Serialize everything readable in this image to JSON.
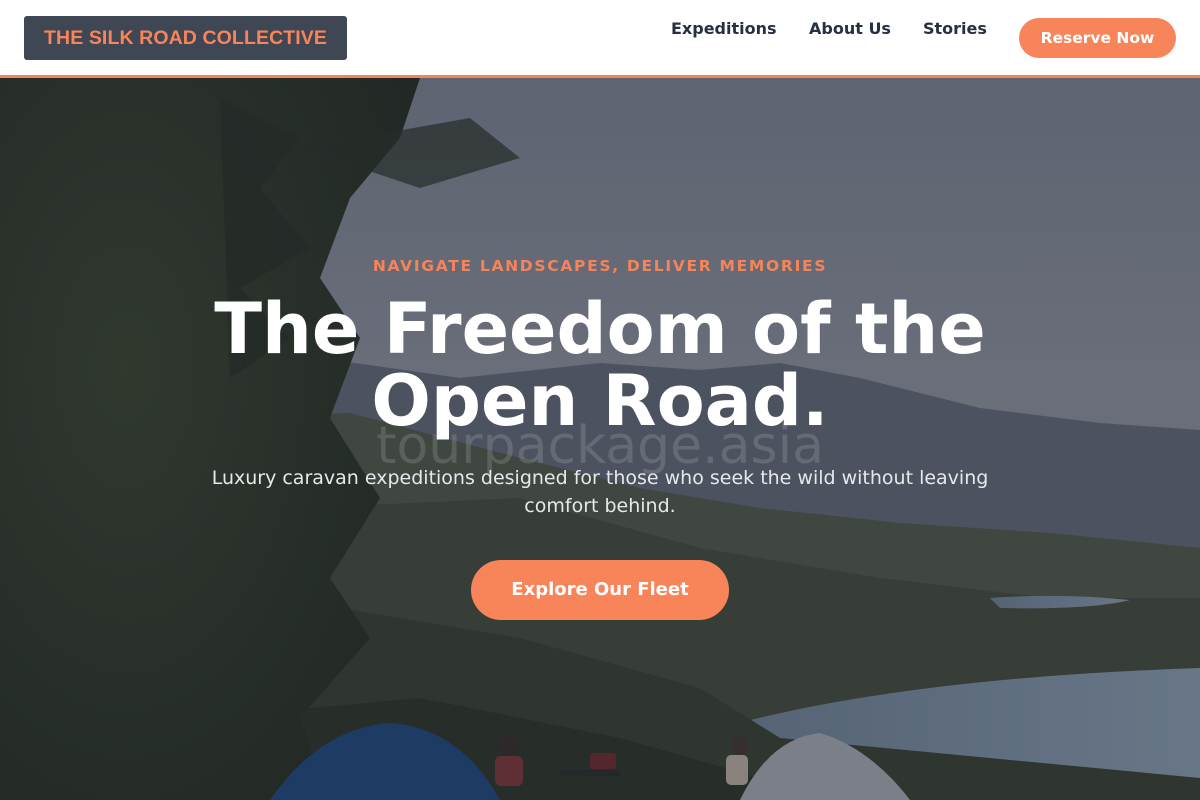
{
  "header": {
    "logo_text": "THE SILK ROAD COLLECTIVE",
    "nav": [
      {
        "label": "Expeditions"
      },
      {
        "label": "About Us"
      },
      {
        "label": "Stories"
      }
    ],
    "cta_label": "Reserve Now"
  },
  "hero": {
    "eyebrow": "NAVIGATE LANDSCAPES, DELIVER MEMORIES",
    "headline": "The Freedom of the Open Road.",
    "watermark": "tourpackage.asia",
    "subtitle": "Luxury caravan expeditions designed for those who seek the wild without leaving comfort behind.",
    "cta_label": "Explore Our Fleet",
    "background_image": "mountain-lake-camping-photo"
  },
  "colors": {
    "accent": "#f8845a",
    "logo_bg": "#3f4654",
    "nav_text": "#263042",
    "white": "#ffffff"
  }
}
